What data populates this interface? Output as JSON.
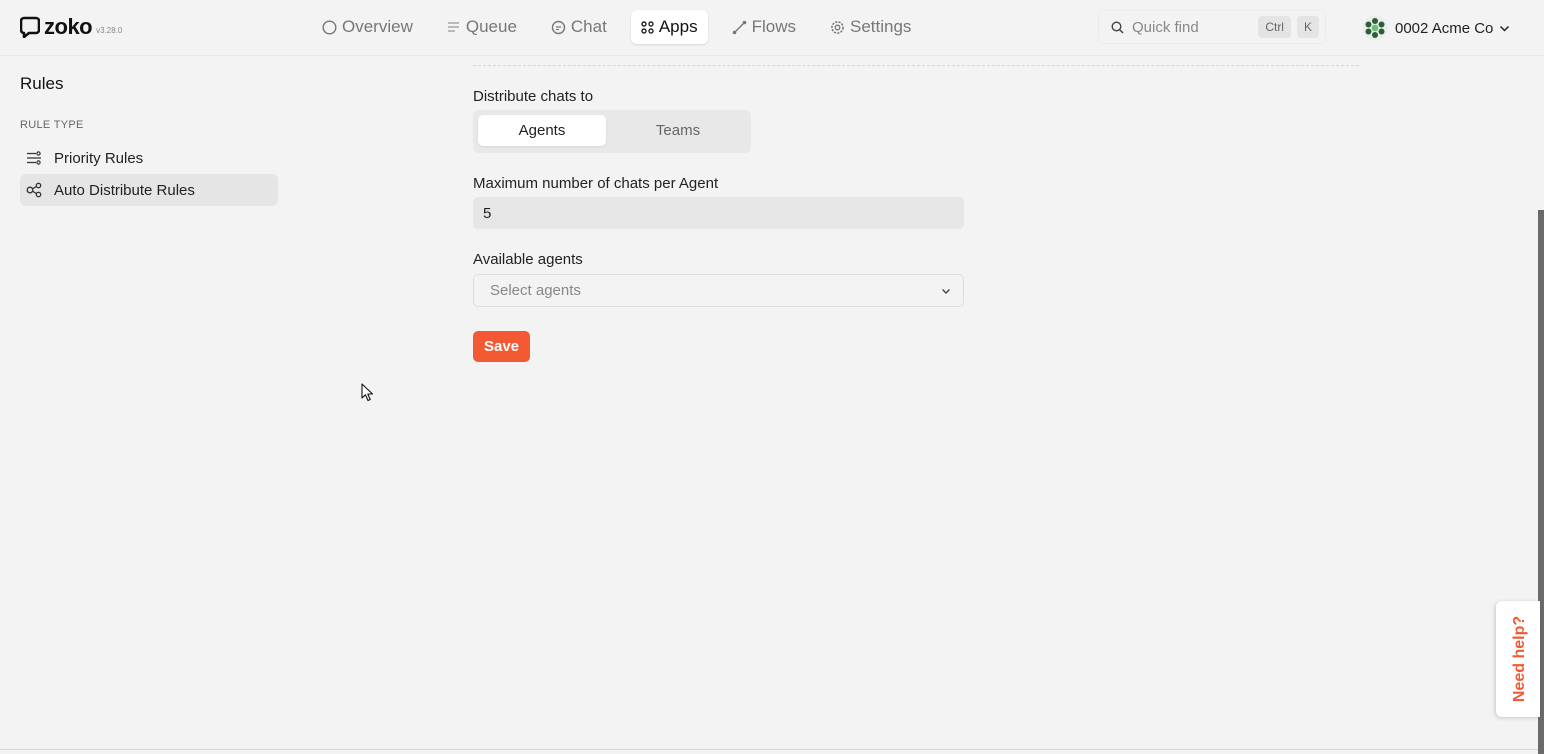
{
  "app": {
    "name": "zoko",
    "version": "v3.28.0"
  },
  "nav": {
    "items": [
      {
        "label": "Overview",
        "icon": "circle-icon"
      },
      {
        "label": "Queue",
        "icon": "queue-icon"
      },
      {
        "label": "Chat",
        "icon": "chat-icon"
      },
      {
        "label": "Apps",
        "icon": "apps-grid-icon",
        "active": true
      },
      {
        "label": "Flows",
        "icon": "flows-icon"
      },
      {
        "label": "Settings",
        "icon": "gear-icon"
      }
    ]
  },
  "search": {
    "label": "Quick find",
    "shortcut_mod": "Ctrl",
    "shortcut_key": "K"
  },
  "account": {
    "name": "0002 Acme Co"
  },
  "sidebar": {
    "title": "Rules",
    "section": "RULE TYPE",
    "items": [
      {
        "label": "Priority Rules",
        "icon": "priority-rules-icon",
        "active": false
      },
      {
        "label": "Auto Distribute Rules",
        "icon": "distribute-icon",
        "active": true
      }
    ]
  },
  "form": {
    "distribute_label": "Distribute chats to",
    "segments": [
      {
        "label": "Agents",
        "active": true
      },
      {
        "label": "Teams",
        "active": false
      }
    ],
    "max_chats_label": "Maximum number of chats per Agent",
    "max_chats_value": "5",
    "available_agents_label": "Available agents",
    "agents_placeholder": "Select agents",
    "save_label": "Save"
  },
  "help": {
    "label": "Need help?"
  },
  "colors": {
    "accent": "#f35a34",
    "background": "#f3f3f3"
  }
}
